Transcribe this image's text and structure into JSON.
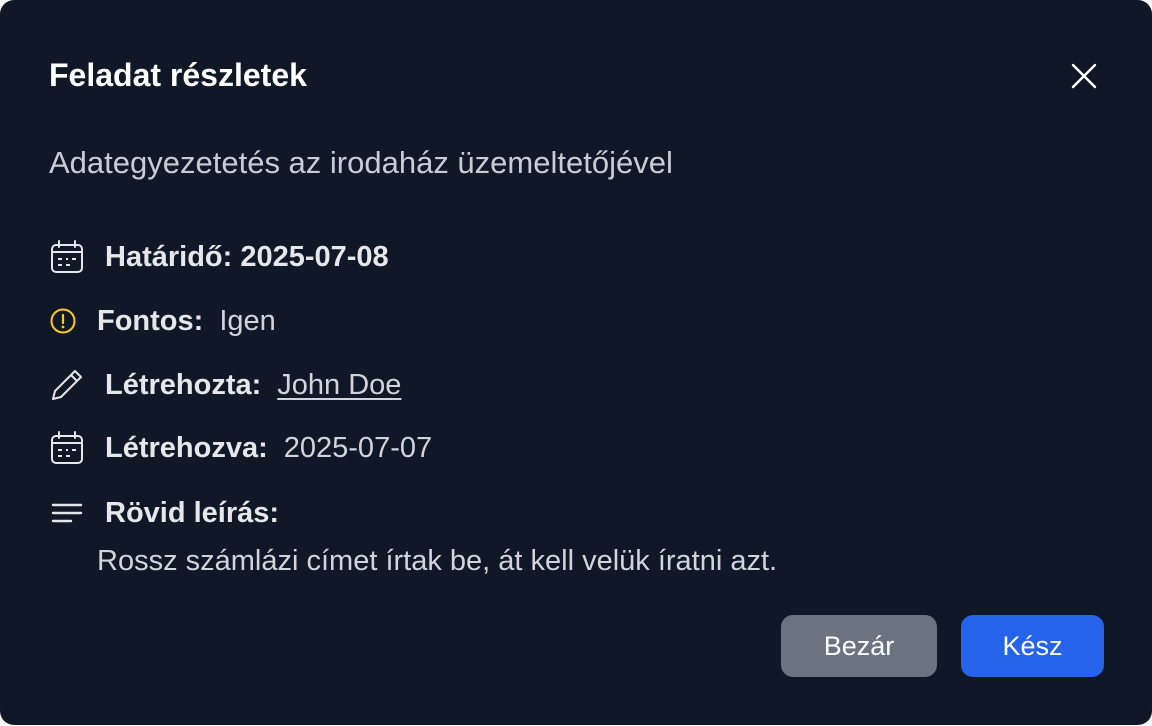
{
  "dialog": {
    "title": "Feladat részletek",
    "task_name": "Adategyezetetés az irodaház üzemeltetőjével"
  },
  "details": {
    "deadline_label": "Határidő: 2025-07-08",
    "important_label": "Fontos:",
    "important_value": "Igen",
    "created_by_label": "Létrehozta:",
    "created_by_value": "John Doe",
    "created_at_label": "Létrehozva:",
    "created_at_value": "2025-07-07",
    "description_label": "Rövid leírás:",
    "description_value": "Rossz számlázi címet írtak be, át kell velük íratni azt."
  },
  "buttons": {
    "close_label": "Bezár",
    "done_label": "Kész"
  },
  "icons": {
    "close": "close-icon",
    "calendar": "calendar-icon",
    "important": "alert-circle-icon",
    "pencil": "pencil-icon",
    "description": "lines-icon"
  },
  "colors": {
    "background": "#101827",
    "primary": "#2563eb",
    "secondary": "#6b7280",
    "warning": "#facc15"
  }
}
